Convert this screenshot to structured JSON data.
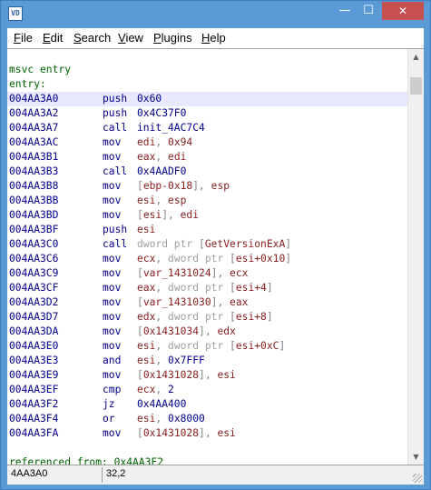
{
  "window": {
    "icon_text": "VD"
  },
  "title_buttons": {
    "minimize": "—",
    "maximize": "☐",
    "close": "✕"
  },
  "menu": [
    {
      "mnemonic": "F",
      "rest": "ile"
    },
    {
      "mnemonic": "E",
      "rest": "dit"
    },
    {
      "mnemonic": "S",
      "rest": "earch"
    },
    {
      "mnemonic": "V",
      "rest": "iew"
    },
    {
      "mnemonic": "P",
      "rest": "lugins"
    },
    {
      "mnemonic": "H",
      "rest": "elp"
    }
  ],
  "code": {
    "labels": [
      "msvc entry",
      "entry:"
    ],
    "selected_row": 0,
    "rows": [
      {
        "addr": "004AA3A0",
        "mnem": "push",
        "ops": [
          [
            "num",
            "0x60"
          ]
        ]
      },
      {
        "addr": "004AA3A2",
        "mnem": "push",
        "ops": [
          [
            "num",
            "0x4C37F0"
          ]
        ]
      },
      {
        "addr": "004AA3A7",
        "mnem": "call",
        "ops": [
          [
            "num",
            "init_4AC7C4"
          ]
        ]
      },
      {
        "addr": "004AA3AC",
        "mnem": "mov",
        "ops": [
          [
            "reg",
            "edi"
          ],
          [
            "pun",
            ", "
          ],
          [
            "reg",
            "0x94"
          ]
        ]
      },
      {
        "addr": "004AA3B1",
        "mnem": "mov",
        "ops": [
          [
            "reg",
            "eax"
          ],
          [
            "pun",
            ", "
          ],
          [
            "reg",
            "edi"
          ]
        ]
      },
      {
        "addr": "004AA3B3",
        "mnem": "call",
        "ops": [
          [
            "num",
            "0x4AADF0"
          ]
        ]
      },
      {
        "addr": "004AA3B8",
        "mnem": "mov",
        "ops": [
          [
            "pun",
            "["
          ],
          [
            "reg",
            "ebp-0x18"
          ],
          [
            "pun",
            "], "
          ],
          [
            "reg",
            "esp"
          ]
        ]
      },
      {
        "addr": "004AA3BB",
        "mnem": "mov",
        "ops": [
          [
            "reg",
            "esi"
          ],
          [
            "pun",
            ", "
          ],
          [
            "reg",
            "esp"
          ]
        ]
      },
      {
        "addr": "004AA3BD",
        "mnem": "mov",
        "ops": [
          [
            "pun",
            "["
          ],
          [
            "reg",
            "esi"
          ],
          [
            "pun",
            "], "
          ],
          [
            "reg",
            "edi"
          ]
        ]
      },
      {
        "addr": "004AA3BF",
        "mnem": "push",
        "ops": [
          [
            "reg",
            "esi"
          ]
        ]
      },
      {
        "addr": "004AA3C0",
        "mnem": "call",
        "ops": [
          [
            "dim",
            "dword ptr "
          ],
          [
            "pun",
            "["
          ],
          [
            "sym",
            "GetVersionExA"
          ],
          [
            "pun",
            "]"
          ]
        ]
      },
      {
        "addr": "004AA3C6",
        "mnem": "mov",
        "ops": [
          [
            "reg",
            "ecx"
          ],
          [
            "pun",
            ", "
          ],
          [
            "dim",
            "dword ptr "
          ],
          [
            "pun",
            "["
          ],
          [
            "reg",
            "esi+0x10"
          ],
          [
            "pun",
            "]"
          ]
        ]
      },
      {
        "addr": "004AA3C9",
        "mnem": "mov",
        "ops": [
          [
            "pun",
            "["
          ],
          [
            "sym",
            "var_1431024"
          ],
          [
            "pun",
            "], "
          ],
          [
            "reg",
            "ecx"
          ]
        ]
      },
      {
        "addr": "004AA3CF",
        "mnem": "mov",
        "ops": [
          [
            "reg",
            "eax"
          ],
          [
            "pun",
            ", "
          ],
          [
            "dim",
            "dword ptr "
          ],
          [
            "pun",
            "["
          ],
          [
            "reg",
            "esi+4"
          ],
          [
            "pun",
            "]"
          ]
        ]
      },
      {
        "addr": "004AA3D2",
        "mnem": "mov",
        "ops": [
          [
            "pun",
            "["
          ],
          [
            "sym",
            "var_1431030"
          ],
          [
            "pun",
            "], "
          ],
          [
            "reg",
            "eax"
          ]
        ]
      },
      {
        "addr": "004AA3D7",
        "mnem": "mov",
        "ops": [
          [
            "reg",
            "edx"
          ],
          [
            "pun",
            ", "
          ],
          [
            "dim",
            "dword ptr "
          ],
          [
            "pun",
            "["
          ],
          [
            "reg",
            "esi+8"
          ],
          [
            "pun",
            "]"
          ]
        ]
      },
      {
        "addr": "004AA3DA",
        "mnem": "mov",
        "ops": [
          [
            "pun",
            "["
          ],
          [
            "sym",
            "0x1431034"
          ],
          [
            "pun",
            "], "
          ],
          [
            "reg",
            "edx"
          ]
        ]
      },
      {
        "addr": "004AA3E0",
        "mnem": "mov",
        "ops": [
          [
            "reg",
            "esi"
          ],
          [
            "pun",
            ", "
          ],
          [
            "dim",
            "dword ptr "
          ],
          [
            "pun",
            "["
          ],
          [
            "reg",
            "esi+0xC"
          ],
          [
            "pun",
            "]"
          ]
        ]
      },
      {
        "addr": "004AA3E3",
        "mnem": "and",
        "ops": [
          [
            "reg",
            "esi"
          ],
          [
            "pun",
            ", "
          ],
          [
            "num",
            "0x7FFF"
          ]
        ]
      },
      {
        "addr": "004AA3E9",
        "mnem": "mov",
        "ops": [
          [
            "pun",
            "["
          ],
          [
            "sym",
            "0x1431028"
          ],
          [
            "pun",
            "], "
          ],
          [
            "reg",
            "esi"
          ]
        ]
      },
      {
        "addr": "004AA3EF",
        "mnem": "cmp",
        "ops": [
          [
            "reg",
            "ecx"
          ],
          [
            "pun",
            ", "
          ],
          [
            "num",
            "2"
          ]
        ]
      },
      {
        "addr": "004AA3F2",
        "mnem": "jz",
        "ops": [
          [
            "num",
            "0x4AA400"
          ]
        ]
      },
      {
        "addr": "004AA3F4",
        "mnem": "or",
        "ops": [
          [
            "reg",
            "esi"
          ],
          [
            "pun",
            ", "
          ],
          [
            "num",
            "0x8000"
          ]
        ]
      },
      {
        "addr": "004AA3FA",
        "mnem": "mov",
        "ops": [
          [
            "pun",
            "["
          ],
          [
            "sym",
            "0x1431028"
          ],
          [
            "pun",
            "], "
          ],
          [
            "reg",
            "esi"
          ]
        ]
      }
    ],
    "footer_label": "referenced from: 0x4AA3F2"
  },
  "scrollbar": {
    "up_glyph": "▲",
    "down_glyph": "▼"
  },
  "status": {
    "address": "4AA3A0",
    "position": "32,2"
  },
  "colors": {
    "title_blue": "#5b9bd5",
    "close_red": "#c75050",
    "address": "#00008b",
    "register": "#8b2020",
    "label": "#006400",
    "selection": "#e8e8ff"
  }
}
